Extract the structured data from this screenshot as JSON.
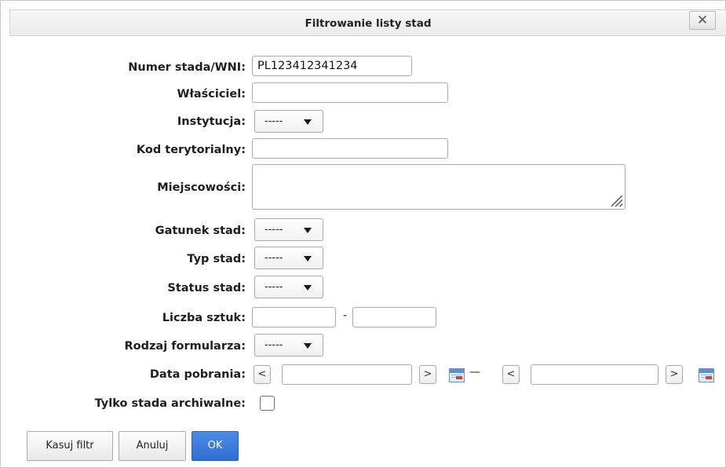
{
  "dialog": {
    "title": "Filtrowanie listy stad",
    "close_label": "✕"
  },
  "form": {
    "herd_number": {
      "label": "Numer stada/WNI:",
      "value": "PL123412341234"
    },
    "owner": {
      "label": "Właściciel:",
      "value": ""
    },
    "institution": {
      "label": "Instytucja:",
      "selected": "-----"
    },
    "territorial_code": {
      "label": "Kod terytorialny:",
      "value": ""
    },
    "localities": {
      "label": "Miejscowości:",
      "value": ""
    },
    "herd_species": {
      "label": "Gatunek stad:",
      "selected": "-----"
    },
    "herd_type": {
      "label": "Typ stad:",
      "selected": "-----"
    },
    "herd_status": {
      "label": "Status stad:",
      "selected": "-----"
    },
    "head_count": {
      "label": "Liczba sztuk:",
      "from": "",
      "separator": "-",
      "to": ""
    },
    "form_type": {
      "label": "Rodzaj formularza:",
      "selected": "-----"
    },
    "download_date": {
      "label": "Data pobrania:",
      "prev": "<",
      "next": ">",
      "range_separator": "—",
      "from": "",
      "to": ""
    },
    "archived_only": {
      "label": "Tylko stada archiwalne:",
      "checked": false
    }
  },
  "buttons": {
    "clear_filter": "Kasuj filtr",
    "cancel": "Anuluj",
    "ok": "OK"
  },
  "colors": {
    "primary_button": "#3a78dc",
    "title_bar": "#efefef",
    "calendar_icon": "#5f8fd2"
  }
}
